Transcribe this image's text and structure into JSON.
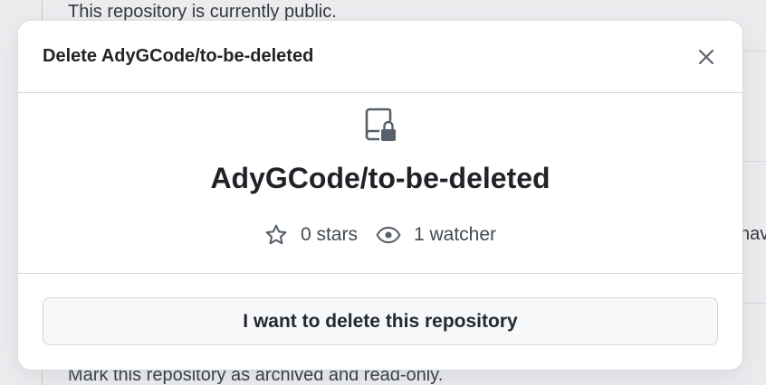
{
  "background": {
    "top_text": "This repository is currently public.",
    "bottom_text": "Mark this repository as archived and read-only.",
    "right_fragment": "hav"
  },
  "dialog": {
    "title": "Delete AdyGCode/to-be-deleted",
    "close_icon": "close-icon",
    "repo_icon": "repo-locked-icon",
    "repo_name": "AdyGCode/to-be-deleted",
    "stats": {
      "stars_icon": "star-icon",
      "stars_label": "0 stars",
      "watchers_icon": "eye-icon",
      "watchers_label": "1 watcher"
    },
    "confirm_button_label": "I want to delete this repository"
  },
  "colors": {
    "text_primary": "#1f2328",
    "text_secondary": "#424a53",
    "border": "#d0d7de",
    "button_bg": "#f6f8fa",
    "backdrop": "#ebecee"
  }
}
